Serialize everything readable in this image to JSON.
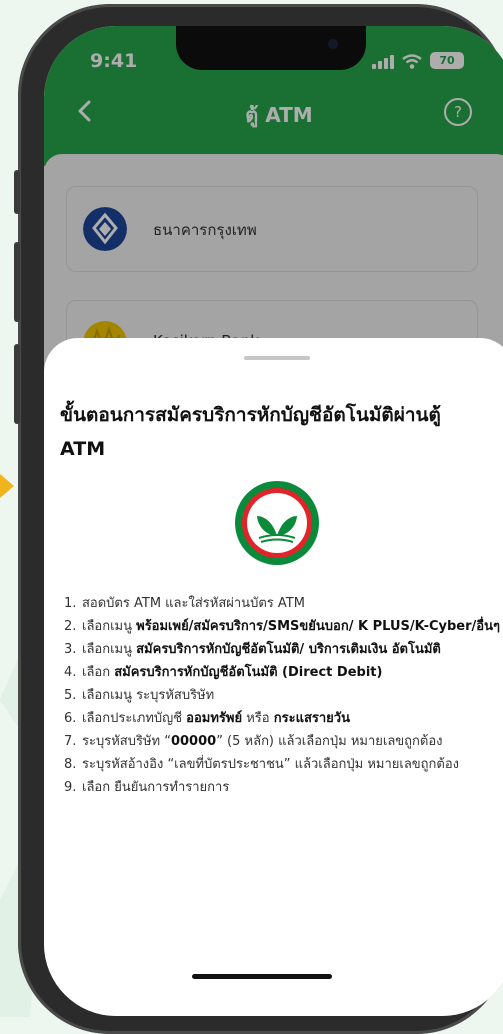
{
  "status_bar": {
    "time": "9:41",
    "battery": "70"
  },
  "header": {
    "title": "ตู้ ATM",
    "help_label": "?"
  },
  "banks": [
    {
      "name": "ธนาคารกรุงเทพ",
      "logo_icon": "bangkok-bank-lotus-icon",
      "color": "#1e4598"
    },
    {
      "name": "Kasikorn Bank",
      "logo_icon": "kasikorn-bank-icon",
      "color": "#f2c500"
    }
  ],
  "sheet": {
    "title": "ขั้นตอนการสมัครบริการหักบัญชีอัตโนมัติผ่านตู้ ATM",
    "logo_icon": "kasikorn-bank-logo-icon",
    "steps": [
      {
        "n": "1.",
        "a": "สอดบัตร ATM และใส่รหัสผ่านบัตร ATM",
        "b": "",
        "c": "",
        "d": "",
        "e": ""
      },
      {
        "n": "2.",
        "a": "เลือกเมนู ",
        "b": "พร้อมเพย์/สมัครบริการ/SMSขยันบอก/ K PLUS/K-Cyber/อื่นๆ",
        "c": "",
        "d": "",
        "e": ""
      },
      {
        "n": "3.",
        "a": "เลือกเมนู ",
        "b": "สมัครบริการหักบัญชีอัตโนมัติ/ บริการเติมเงิน อัตโนมัติ",
        "c": "",
        "d": "",
        "e": ""
      },
      {
        "n": "4.",
        "a": "เลือก ",
        "b": "สมัครบริการหักบัญชีอัตโนมัติ (Direct Debit)",
        "c": "",
        "d": "",
        "e": ""
      },
      {
        "n": "5.",
        "a": "เลือกเมนู ระบุรหัสบริษัท",
        "b": "",
        "c": "",
        "d": "",
        "e": ""
      },
      {
        "n": "6.",
        "a": "เลือกประเภทบัญชี ",
        "b": "ออมทรัพย์",
        "c": " หรือ ",
        "d": "กระแสรายวัน",
        "e": ""
      },
      {
        "n": "7.",
        "a": "ระบุรหัสบริษัท “",
        "b": "00000",
        "c": "” (5 หลัก) แล้วเลือกปุ่ม หมายเลขถูกต้อง",
        "d": "",
        "e": ""
      },
      {
        "n": "8.",
        "a": "ระบุรหัสอ้างอิง “เลขที่บัตรประชาชน” แล้วเลือกปุ่ม หมายเลขถูกต้อง",
        "b": "",
        "c": "",
        "d": "",
        "e": ""
      },
      {
        "n": "9.",
        "a": "เลือก ยืนยันการทำรายการ",
        "b": "",
        "c": "",
        "d": "",
        "e": ""
      }
    ]
  },
  "colors": {
    "brand_green": "#27a54b",
    "kbank_green": "#0a8a3a",
    "kbank_red": "#e3232a",
    "pointer": "#f0b41c"
  }
}
